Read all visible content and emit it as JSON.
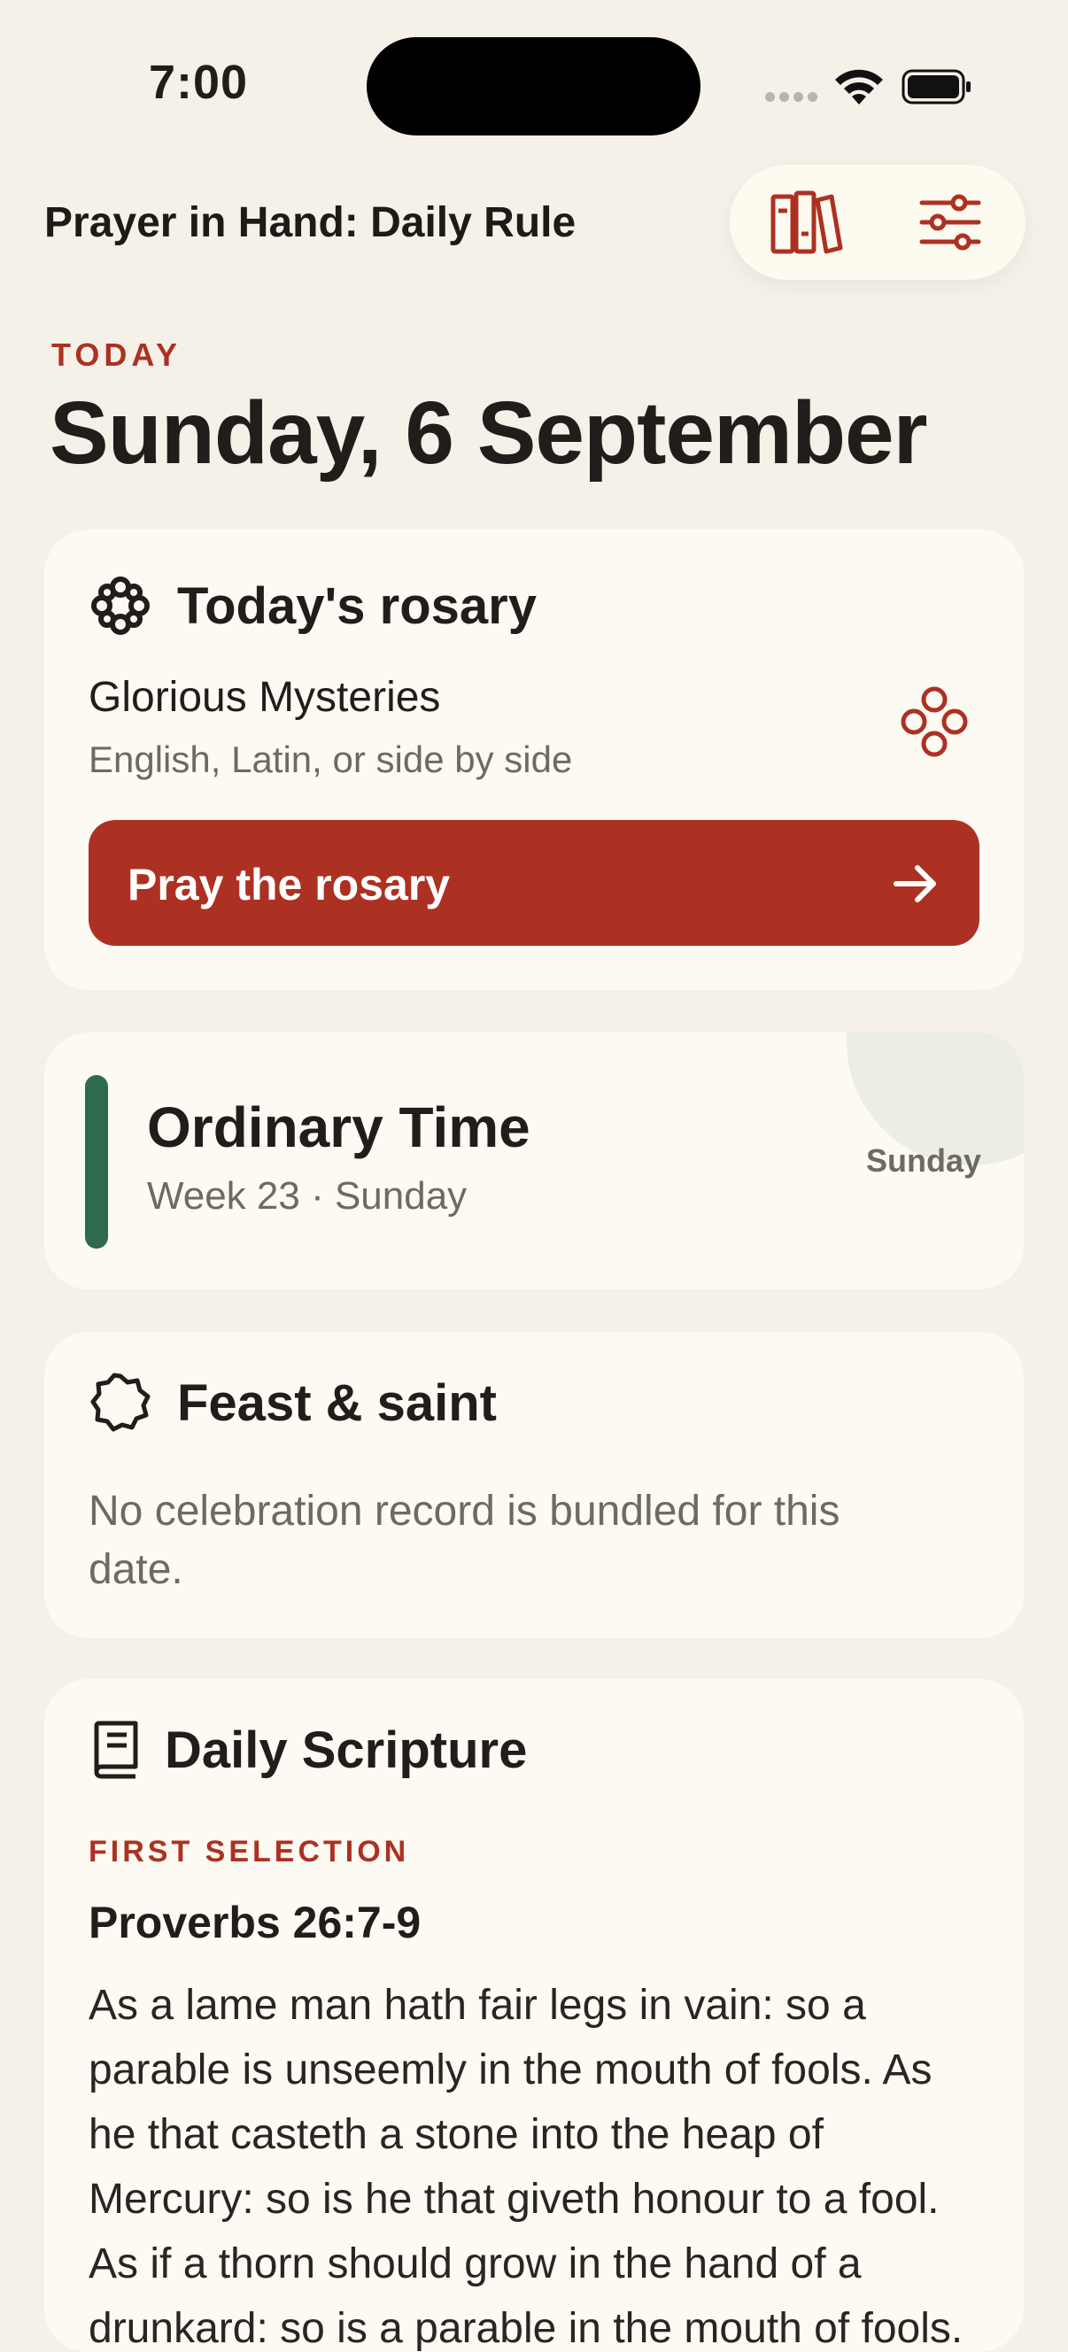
{
  "status_bar": {
    "time": "7:00"
  },
  "header": {
    "title": "Prayer in Hand: Daily Rule",
    "library_icon": "books-icon",
    "settings_icon": "sliders-icon"
  },
  "today": {
    "label": "TODAY",
    "date": "Sunday, 6 September"
  },
  "rosary_card": {
    "title": "Today's rosary",
    "mystery": "Glorious Mysteries",
    "subtitle": "English, Latin, or side by side",
    "button_label": "Pray the rosary"
  },
  "season_card": {
    "title": "Ordinary Time",
    "subtitle": "Week 23 · Sunday",
    "day": "Sunday",
    "season_color": "#2e6a4c"
  },
  "feast_card": {
    "title": "Feast & saint",
    "message": "No celebration record is bundled for this date."
  },
  "scripture_card": {
    "title": "Daily Scripture",
    "selection_label": "FIRST SELECTION",
    "reference": "Proverbs 26:7-9",
    "text": "As a lame man hath fair legs in vain: so a parable is unseemly in the mouth of fools. As he that casteth a stone into the heap of Mercury: so is he that giveth honour to a fool. As if a thorn should grow in the hand of a drunkard: so is a parable in the mouth of fools."
  },
  "colors": {
    "accent": "#ad3122",
    "background": "#f5f1e8",
    "card": "#fcfaf3"
  }
}
